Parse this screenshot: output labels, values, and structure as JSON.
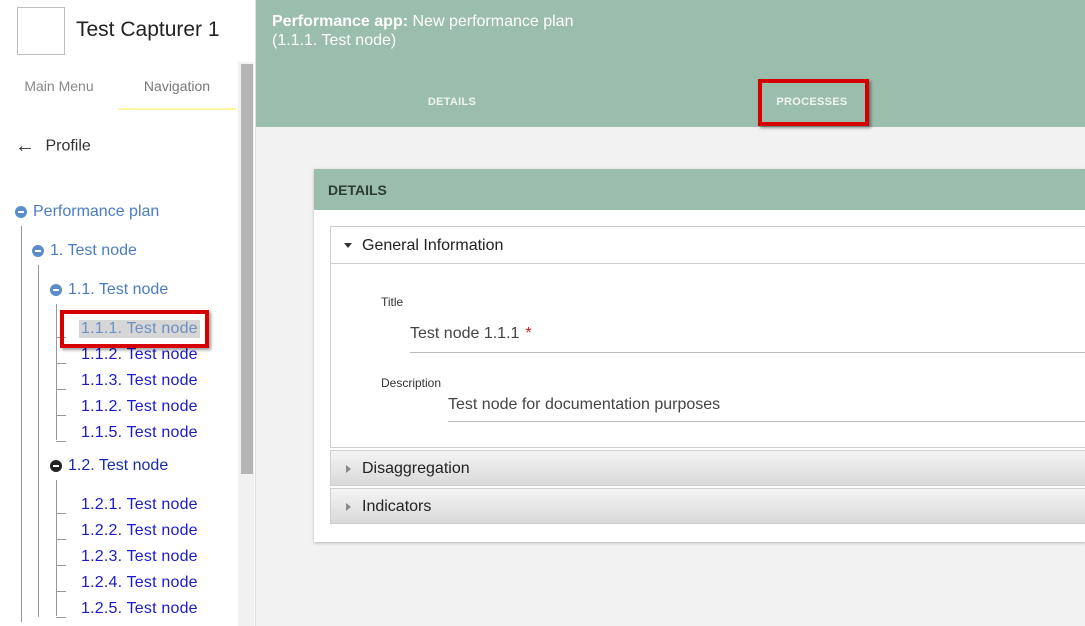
{
  "user": {
    "name": "Test Capturer 1"
  },
  "sidebar": {
    "tabs": [
      "Main Menu",
      "Navigation"
    ],
    "back_label": "Profile",
    "back_icon": "arrow-left-icon",
    "tree": {
      "root": "Performance plan",
      "node_1": "1. Test node",
      "node_1_1": "1.1. Test node",
      "node_1_1_children": [
        "1.1.1. Test node",
        "1.1.2. Test node",
        "1.1.3. Test node",
        "1.1.2. Test node",
        "1.1.5. Test node"
      ],
      "node_1_2": "1.2. Test node",
      "node_1_2_children": [
        "1.2.1. Test node",
        "1.2.2. Test node",
        "1.2.3. Test node",
        "1.2.4. Test node",
        "1.2.5. Test node"
      ],
      "selected": "1.1.1. Test node"
    }
  },
  "header": {
    "app_label": "Performance app:",
    "plan_title": "New performance plan",
    "node_path": "(1.1.1. Test node)",
    "tabs": [
      "DETAILS",
      "PROCESSES"
    ]
  },
  "details": {
    "heading": "DETAILS",
    "general": {
      "title": "General Information",
      "title_label": "Title",
      "title_value": "Test node 1.1.1",
      "required_mark": "*",
      "description_label": "Description",
      "description_value": "Test node for documentation purposes"
    },
    "panels": [
      "Disaggregation",
      "Indicators"
    ]
  },
  "colors": {
    "header": "#9bbdac",
    "highlight": "#d60000",
    "link": "#1a1acc",
    "tree_blue": "#4a7dc0"
  }
}
